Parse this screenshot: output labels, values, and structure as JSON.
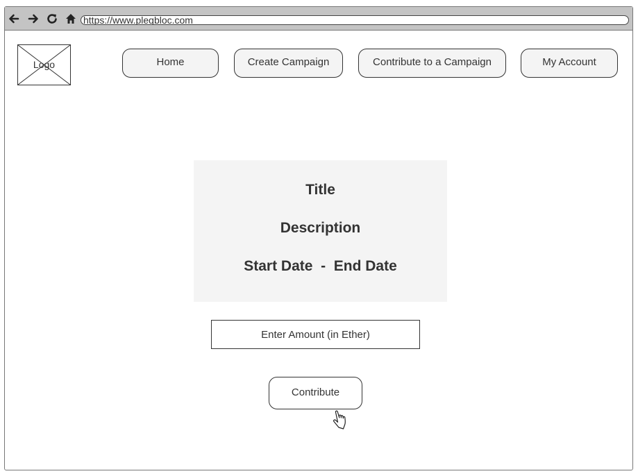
{
  "browser": {
    "url": "https://www.plegbloc.com",
    "icons": [
      "back-arrow-icon",
      "forward-arrow-icon",
      "refresh-icon",
      "home-icon"
    ]
  },
  "header": {
    "logo_label": "Logo",
    "nav": {
      "home": "Home",
      "create_campaign": "Create Campaign",
      "contribute_campaign": "Contribute to a Campaign",
      "my_account": "My Account"
    }
  },
  "campaign": {
    "title": "Title",
    "description": "Description",
    "date_range": "Start Date  -  End Date"
  },
  "form": {
    "amount_placeholder": "Enter Amount (in Ether)",
    "contribute_label": "Contribute"
  },
  "colors": {
    "browser_bar": "#c4c4c4",
    "card_background": "#f4f4f4",
    "text": "#333333"
  }
}
